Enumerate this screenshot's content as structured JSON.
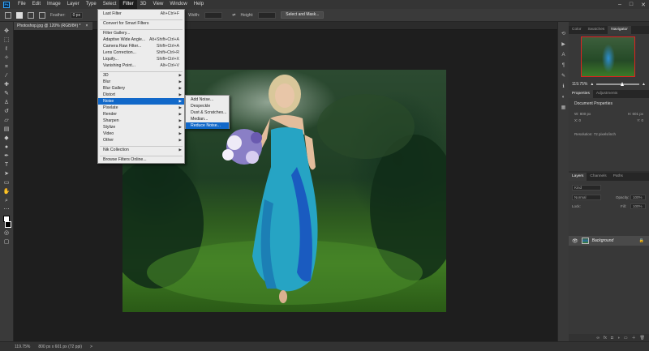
{
  "menubar": {
    "items": [
      "File",
      "Edit",
      "Image",
      "Layer",
      "Type",
      "Select",
      "Filter",
      "3D",
      "View",
      "Window",
      "Help"
    ],
    "active": "Filter",
    "window_controls": [
      "–",
      "□",
      "✕"
    ]
  },
  "options": {
    "feather_label": "Feather:",
    "feather_value": "0 px",
    "width_label": "Width:",
    "height_label": "Height:",
    "select_mask_label": "Select and Mask..."
  },
  "document": {
    "tab_title": "Photoshop.jpg @ 120% (RGB/8#) *",
    "tab_close": "×"
  },
  "status": {
    "zoom": "119.75%",
    "doc_size": "800 px x 601 px (72 ppi)",
    "arrow": ">"
  },
  "filter_menu": {
    "items": [
      {
        "label": "Last Filter",
        "shortcut": "Alt+Ctrl+F"
      },
      {
        "label": "Convert for Smart Filters",
        "shortcut": ""
      },
      {
        "label": "Filter Gallery...",
        "shortcut": ""
      },
      {
        "label": "Adaptive Wide Angle...",
        "shortcut": "Alt+Shift+Ctrl+A"
      },
      {
        "label": "Camera Raw Filter...",
        "shortcut": "Shift+Ctrl+A"
      },
      {
        "label": "Lens Correction...",
        "shortcut": "Shift+Ctrl+R"
      },
      {
        "label": "Liquify...",
        "shortcut": "Shift+Ctrl+X"
      },
      {
        "label": "Vanishing Point...",
        "shortcut": "Alt+Ctrl+V"
      },
      {
        "label": "3D",
        "submenu": true
      },
      {
        "label": "Blur",
        "submenu": true
      },
      {
        "label": "Blur Gallery",
        "submenu": true
      },
      {
        "label": "Distort",
        "submenu": true
      },
      {
        "label": "Noise",
        "submenu": true,
        "highlighted": true
      },
      {
        "label": "Pixelate",
        "submenu": true
      },
      {
        "label": "Render",
        "submenu": true
      },
      {
        "label": "Sharpen",
        "submenu": true
      },
      {
        "label": "Stylize",
        "submenu": true
      },
      {
        "label": "Video",
        "submenu": true
      },
      {
        "label": "Other",
        "submenu": true
      },
      {
        "label": "Nik Collection",
        "submenu": true
      },
      {
        "label": "Browse Filters Online...",
        "shortcut": ""
      }
    ]
  },
  "noise_menu": {
    "items": [
      {
        "label": "Add Noise..."
      },
      {
        "label": "Despeckle"
      },
      {
        "label": "Dust & Scratches..."
      },
      {
        "label": "Median..."
      },
      {
        "label": "Reduce Noise...",
        "highlighted": true
      }
    ]
  },
  "panels": {
    "top_tabs": [
      "Color",
      "Swatches",
      "Navigator"
    ],
    "zoom": "119.75%",
    "prop_tabs": [
      "Properties",
      "Adjustments"
    ],
    "doc_props_title": "Document Properties",
    "w_label": "W:",
    "w_value": "800 px",
    "h_label": "H:",
    "h_value": "601 px",
    "x_label": "X:",
    "x_value": "0",
    "y_label": "Y:",
    "y_value": "0",
    "resolution": "Resolution: 72 pixels/inch",
    "layer_tabs": [
      "Layers",
      "Channels",
      "Paths"
    ],
    "kind": "Kind",
    "blend_mode": "Normal",
    "opacity_label": "Opacity:",
    "opacity_value": "100%",
    "lock_label": "Lock:",
    "fill_label": "Fill:",
    "fill_value": "100%",
    "layer_name": "Background"
  }
}
